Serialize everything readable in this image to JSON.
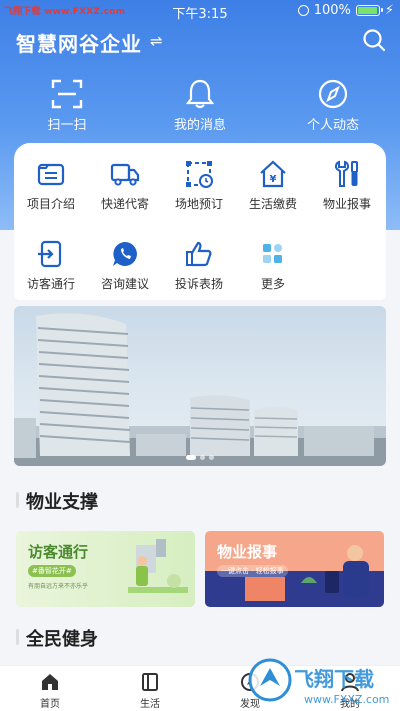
{
  "status_bar": {
    "watermark": "飞翔下载 www.FXXZ.com",
    "time": "下午3:15",
    "battery": "100%",
    "battery_level": 1.0
  },
  "header": {
    "title": "智慧网谷企业",
    "switch_icon": "swap-icon",
    "search_icon": "search-icon"
  },
  "quick_actions": [
    {
      "label": "扫一扫",
      "icon": "scan-icon"
    },
    {
      "label": "我的消息",
      "icon": "bell-icon"
    },
    {
      "label": "个人动态",
      "icon": "compass-icon"
    }
  ],
  "services": [
    {
      "label": "项目介绍",
      "icon": "list-icon"
    },
    {
      "label": "快递代寄",
      "icon": "truck-icon"
    },
    {
      "label": "场地预订",
      "icon": "venue-icon"
    },
    {
      "label": "生活缴费",
      "icon": "home-yuan-icon"
    },
    {
      "label": "物业报事",
      "icon": "tools-icon"
    },
    {
      "label": "访客通行",
      "icon": "visitor-icon"
    },
    {
      "label": "咨询建议",
      "icon": "chat-icon"
    },
    {
      "label": "投诉表扬",
      "icon": "thumbs-up-icon"
    },
    {
      "label": "更多",
      "icon": "grid-icon"
    }
  ],
  "sections": {
    "property": "物业支撑",
    "fitness": "全民健身"
  },
  "promos": [
    {
      "title": "访客通行",
      "tag": "#番智花开#",
      "subtitle": "有朋自远方来不亦乐乎",
      "color": "#4a8a2c"
    },
    {
      "title": "物业报事",
      "tag": "一键点击 · 轻松报事",
      "subtitle": "",
      "color": "#ffffff"
    }
  ],
  "bottom_nav": [
    {
      "label": "首页",
      "icon": "home-icon"
    },
    {
      "label": "生活",
      "icon": "book-icon"
    },
    {
      "label": "发现",
      "icon": "compass-icon"
    },
    {
      "label": "我的",
      "icon": "user-icon"
    }
  ],
  "watermark_logo": {
    "text": "飞翔下载",
    "url": "www.FXXZ.com"
  },
  "colors": {
    "primary": "#3d7fe6",
    "icon_blue": "#1f5fc8"
  }
}
